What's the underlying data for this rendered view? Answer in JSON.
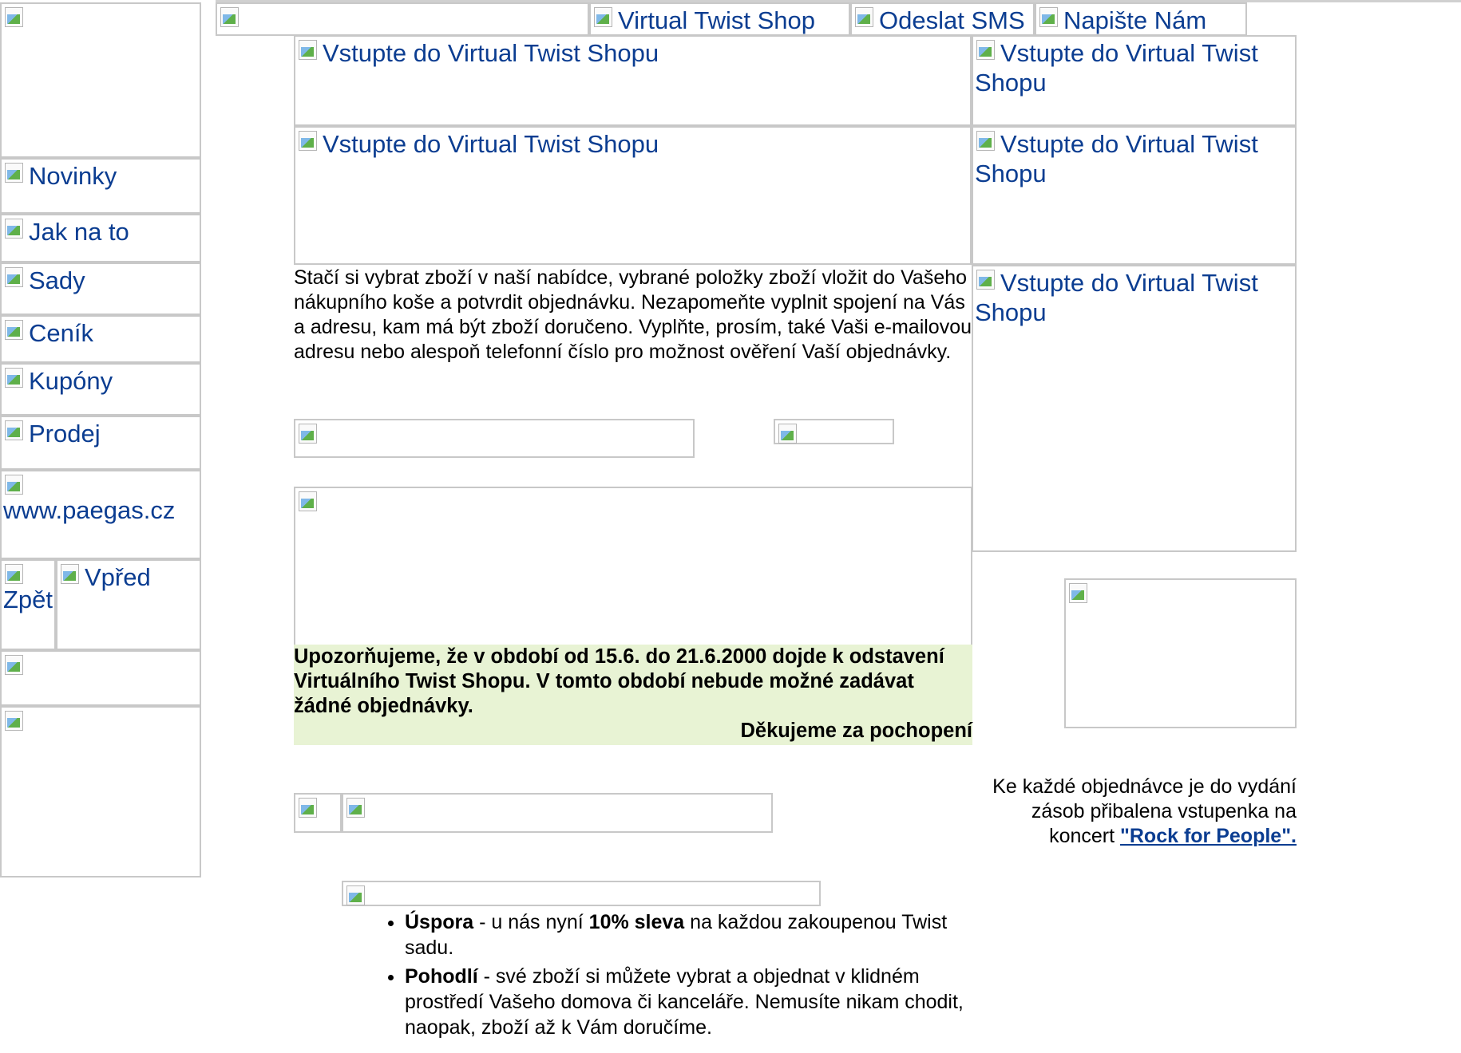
{
  "top_nav": {
    "virtual_twist_shop": "Virtual Twist Shop",
    "send_sms": "Odeslat SMS",
    "write_us": "Napište Nám"
  },
  "banners": {
    "enter_shop": "Vstupte do Virtual Twist Shopu"
  },
  "sidebar": {
    "items": [
      {
        "label": "Novinky"
      },
      {
        "label": "Jak na to"
      },
      {
        "label": "Sady"
      },
      {
        "label": "Ceník"
      },
      {
        "label": "Kupóny"
      },
      {
        "label": "Prodej"
      },
      {
        "label": "www.paegas.cz"
      }
    ],
    "back": "Zpět",
    "forward": "Vpřed"
  },
  "main": {
    "intro": "Stačí si vybrat zboží v naší nabídce, vybrané položky zboží vložit do Vašeho nákupního koše a potvrdit objednávku. Nezapomeňte vyplnit spojení na Vás a adresu, kam má být zboží doručeno. Vyplňte, prosím, také Vaši e-mailovou adresu nebo alespoň telefonní číslo pro možnost ověření Vaší objednávky.",
    "notice": "Upozorňujeme, že v období od 15.6. do 21.6.2000 dojde k odstavení Virtuálního Twist Shopu. V tomto období nebude možné zadávat žádné objednávky.",
    "notice_thanks": "Děkujeme za pochopení",
    "benefits": [
      {
        "title": "Úspora",
        "pre": " - u nás nyní ",
        "strong": "10% sleva",
        "post": " na každou zakoupenou Twist sadu."
      },
      {
        "title": "Pohodlí",
        "pre": " - své zboží si můžete vybrat a objednat v klidném prostředí Vašeho domova či kanceláře. Nemusíte nikam chodit, naopak, zboží až k Vám doručíme."
      }
    ]
  },
  "right": {
    "concert_text": "Ke každé objednávce je do vydání zásob přibalena vstupenka na koncert",
    "concert_link": "\"Rock for People\"."
  },
  "colors": {
    "link": "#0b3d91",
    "notice_bg": "#e8f3d4",
    "border": "#c8c8c8"
  }
}
